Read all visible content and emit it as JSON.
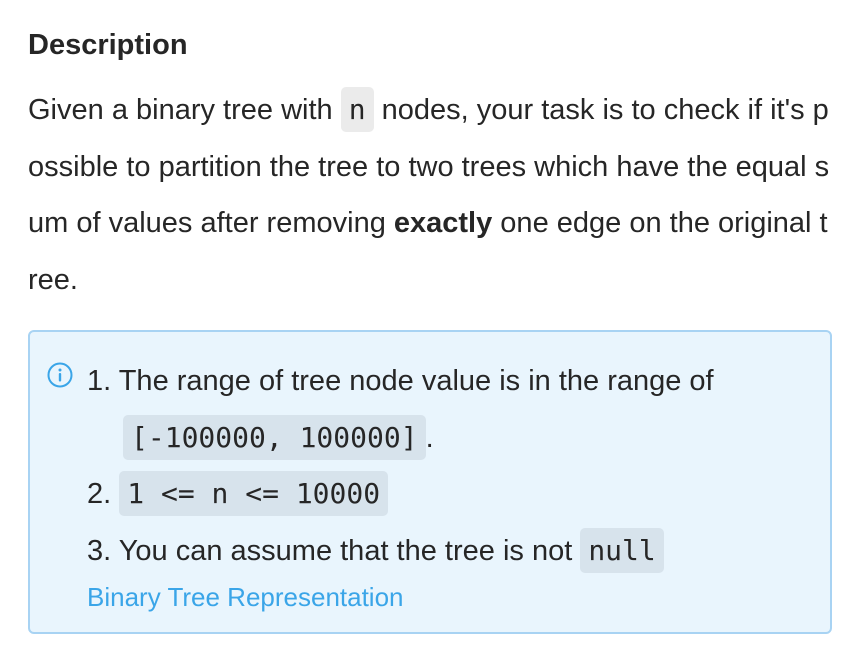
{
  "section": {
    "heading": "Description"
  },
  "description": {
    "part1": "Given a binary tree with ",
    "code_n": "n",
    "part2": " nodes, your task is to check if it's possible to partition the tree to two trees which have the equal sum of values after removing ",
    "emphasis": "exactly",
    "part3": " one edge on the original tree."
  },
  "notes": {
    "icon": "info-icon",
    "items": [
      {
        "number": "1.",
        "text": " The range of tree node value is in the range of",
        "code": "[-100000, 100000]",
        "suffix": "."
      },
      {
        "number": "2.",
        "code": "1 <= n <= 10000"
      },
      {
        "number": "3.",
        "text": " You can assume that the tree is not ",
        "code": "null"
      }
    ],
    "link": "Binary Tree Representation"
  },
  "colors": {
    "callout_bg": "#e9f5fd",
    "callout_border": "#a8d3f3",
    "link": "#3aa5e8",
    "code_bg": "#ebebeb"
  }
}
